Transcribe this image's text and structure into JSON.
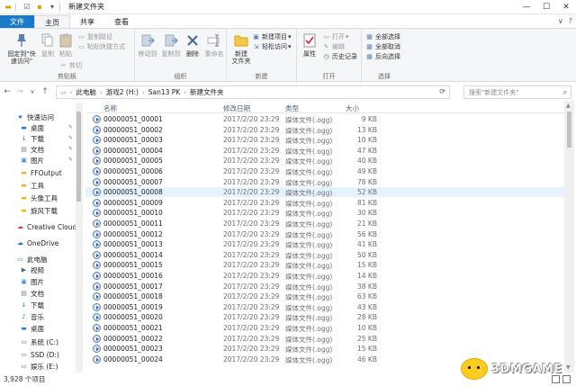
{
  "window": {
    "title": "新建文件夹",
    "controls": [
      "—",
      "☐",
      "✕"
    ]
  },
  "tabs": [
    {
      "label": "文件"
    },
    {
      "label": "主页"
    },
    {
      "label": "共享"
    },
    {
      "label": "查看"
    }
  ],
  "ribbon": {
    "clipboard": {
      "label": "剪贴板",
      "pin": "固定到\"快速访问\"",
      "copy": "复制",
      "paste": "粘贴",
      "copy_path": "复制路径",
      "paste_shortcut": "粘贴快捷方式",
      "cut": "剪切"
    },
    "organize": {
      "label": "组织",
      "move_to": "移动到",
      "copy_to": "复制到",
      "delete": "删除",
      "rename": "重命名"
    },
    "new": {
      "label": "新建",
      "new_folder": "新建\n文件夹",
      "new_item": "新建项目",
      "easy_access": "轻松访问"
    },
    "open": {
      "label": "打开",
      "properties": "属性",
      "open": "打开",
      "edit": "编辑",
      "history": "历史记录"
    },
    "select": {
      "label": "选择",
      "select_all": "全部选择",
      "select_none": "全部取消",
      "invert": "反向选择"
    }
  },
  "address": {
    "crumbs": [
      "此电脑",
      "游戏2 (H:)",
      "San13 PK",
      "新建文件夹"
    ],
    "search_placeholder": "搜索\"新建文件夹\""
  },
  "nav": {
    "items": [
      {
        "label": "快速访问",
        "icon": "star-icon",
        "pinned": false
      },
      {
        "label": "桌面",
        "icon": "desktop-icon",
        "pinned": true
      },
      {
        "label": "下载",
        "icon": "download-icon",
        "pinned": true
      },
      {
        "label": "文档",
        "icon": "document-icon",
        "pinned": true
      },
      {
        "label": "图片",
        "icon": "picture-icon",
        "pinned": true
      },
      {
        "label": "FFOutput",
        "icon": "folder-icon",
        "pinned": false
      },
      {
        "label": "工具",
        "icon": "folder-icon",
        "pinned": false
      },
      {
        "label": "头像工具",
        "icon": "folder-icon",
        "pinned": false
      },
      {
        "label": "旋风下载",
        "icon": "folder-icon",
        "pinned": false
      },
      {
        "label": "Creative Cloud F",
        "icon": "cloud-icon",
        "pinned": false
      },
      {
        "label": "OneDrive",
        "icon": "onedrive-icon",
        "pinned": false
      },
      {
        "label": "此电脑",
        "icon": "computer-icon",
        "pinned": false
      },
      {
        "label": "视频",
        "icon": "video-icon",
        "pinned": false
      },
      {
        "label": "图片",
        "icon": "picture-icon",
        "pinned": false
      },
      {
        "label": "文档",
        "icon": "document-icon",
        "pinned": false
      },
      {
        "label": "下载",
        "icon": "download-icon",
        "pinned": false
      },
      {
        "label": "音乐",
        "icon": "music-icon",
        "pinned": false
      },
      {
        "label": "桌面",
        "icon": "desktop-icon",
        "pinned": false
      },
      {
        "label": "系统 (C:)",
        "icon": "drive-icon",
        "pinned": false
      },
      {
        "label": "SSD (D:)",
        "icon": "drive-icon",
        "pinned": false
      },
      {
        "label": "娱乐 (E:)",
        "icon": "drive-icon",
        "pinned": false
      }
    ]
  },
  "columns": {
    "name": "名称",
    "date": "修改日期",
    "type": "类型",
    "size": "大小"
  },
  "files": [
    {
      "name": "00000051_00001",
      "date": "2017/2/20 23:29",
      "type": "媒体文件(.ogg)",
      "size": "9 KB"
    },
    {
      "name": "00000051_00002",
      "date": "2017/2/20 23:29",
      "type": "媒体文件(.ogg)",
      "size": "13 KB"
    },
    {
      "name": "00000051_00003",
      "date": "2017/2/20 23:29",
      "type": "媒体文件(.ogg)",
      "size": "10 KB"
    },
    {
      "name": "00000051_00004",
      "date": "2017/2/20 23:29",
      "type": "媒体文件(.ogg)",
      "size": "47 KB"
    },
    {
      "name": "00000051_00005",
      "date": "2017/2/20 23:29",
      "type": "媒体文件(.ogg)",
      "size": "40 KB"
    },
    {
      "name": "00000051_00006",
      "date": "2017/2/20 23:29",
      "type": "媒体文件(.ogg)",
      "size": "49 KB"
    },
    {
      "name": "00000051_00007",
      "date": "2017/2/20 23:29",
      "type": "媒体文件(.ogg)",
      "size": "78 KB"
    },
    {
      "name": "00000051_00008",
      "date": "2017/2/20 23:29",
      "type": "媒体文件(.ogg)",
      "size": "52 KB"
    },
    {
      "name": "00000051_00009",
      "date": "2017/2/20 23:29",
      "type": "媒体文件(.ogg)",
      "size": "81 KB"
    },
    {
      "name": "00000051_00010",
      "date": "2017/2/20 23:29",
      "type": "媒体文件(.ogg)",
      "size": "30 KB"
    },
    {
      "name": "00000051_00011",
      "date": "2017/2/20 23:29",
      "type": "媒体文件(.ogg)",
      "size": "21 KB"
    },
    {
      "name": "00000051_00012",
      "date": "2017/2/20 23:29",
      "type": "媒体文件(.ogg)",
      "size": "56 KB"
    },
    {
      "name": "00000051_00013",
      "date": "2017/2/20 23:29",
      "type": "媒体文件(.ogg)",
      "size": "41 KB"
    },
    {
      "name": "00000051_00014",
      "date": "2017/2/20 23:29",
      "type": "媒体文件(.ogg)",
      "size": "50 KB"
    },
    {
      "name": "00000051_00015",
      "date": "2017/2/20 23:29",
      "type": "媒体文件(.ogg)",
      "size": "15 KB"
    },
    {
      "name": "00000051_00016",
      "date": "2017/2/20 23:29",
      "type": "媒体文件(.ogg)",
      "size": "14 KB"
    },
    {
      "name": "00000051_00017",
      "date": "2017/2/20 23:29",
      "type": "媒体文件(.ogg)",
      "size": "38 KB"
    },
    {
      "name": "00000051_00018",
      "date": "2017/2/20 23:29",
      "type": "媒体文件(.ogg)",
      "size": "63 KB"
    },
    {
      "name": "00000051_00019",
      "date": "2017/2/20 23:29",
      "type": "媒体文件(.ogg)",
      "size": "43 KB"
    },
    {
      "name": "00000051_00020",
      "date": "2017/2/20 23:29",
      "type": "媒体文件(.ogg)",
      "size": "28 KB"
    },
    {
      "name": "00000051_00021",
      "date": "2017/2/20 23:29",
      "type": "媒体文件(.ogg)",
      "size": "10 KB"
    },
    {
      "name": "00000051_00022",
      "date": "2017/2/20 23:29",
      "type": "媒体文件(.ogg)",
      "size": "25 KB"
    },
    {
      "name": "00000051_00023",
      "date": "2017/2/20 23:29",
      "type": "媒体文件(.ogg)",
      "size": "15 KB"
    },
    {
      "name": "00000051_00024",
      "date": "2017/2/20 23:29",
      "type": "媒体文件(.ogg)",
      "size": "46 KB"
    }
  ],
  "selected_file": "00000051_00008",
  "status": {
    "count": "3,928 个项目"
  },
  "watermark": "3DMGAME",
  "colors": {
    "file_tab": "#1979ca",
    "selection": "#e5f3ff",
    "header_text": "#4c607a"
  }
}
